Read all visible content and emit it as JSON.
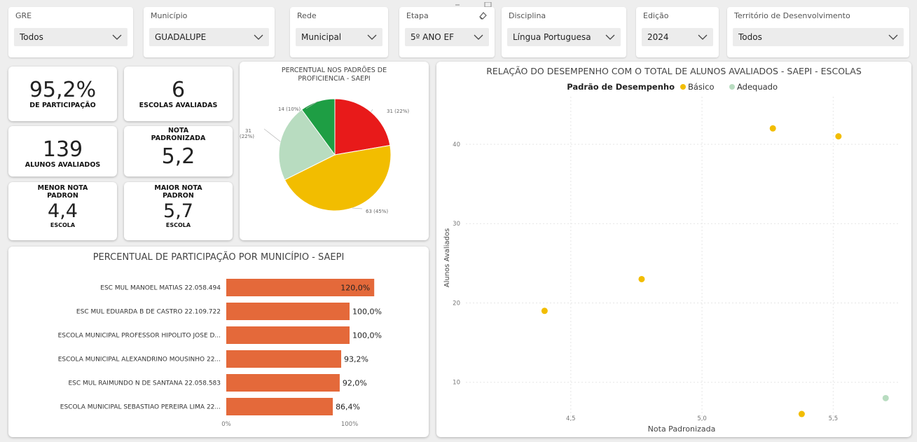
{
  "filters": [
    {
      "label": "GRE",
      "value": "Todos"
    },
    {
      "label": "Município",
      "value": "GUADALUPE"
    },
    {
      "label": "Rede",
      "value": "Municipal"
    },
    {
      "label": "Etapa",
      "value": "5º ANO EF"
    },
    {
      "label": "Disciplina",
      "value": "Língua Portuguesa"
    },
    {
      "label": "Edição",
      "value": "2024"
    },
    {
      "label": "Território de Desenvolvimento",
      "value": "Todos"
    }
  ],
  "kpis": {
    "participacao": {
      "value": "95,2%",
      "label": "DE PARTICIPAÇÃO"
    },
    "escolas": {
      "value": "6",
      "label": "ESCOLAS AVALIADAS"
    },
    "alunos": {
      "value": "139",
      "label": "ALUNOS AVALIADOS"
    },
    "nota": {
      "value": "5,2",
      "label1": "NOTA",
      "label2": "PADRONIZADA"
    },
    "menor": {
      "value": "4,4",
      "label1": "MENOR NOTA",
      "label2": "PADRON",
      "sub": "ESCOLA"
    },
    "maior": {
      "value": "5,7",
      "label1": "MAIOR NOTA",
      "label2": "PADRON",
      "sub": "ESCOLA"
    }
  },
  "colors": {
    "red": "#e81a1a",
    "yellow": "#f2bd00",
    "light_green": "#b8dcc0",
    "green": "#1e9e44",
    "bar": "#e4693a",
    "basico": "#f2bd00",
    "adequado": "#b8dcc0"
  },
  "chart_data": [
    {
      "type": "pie",
      "title": "PERCENTUAL NOS PADRÕES DE PROFICIENCIA - SAEPI",
      "slices": [
        {
          "label": "31 (22%)",
          "value": 31,
          "color": "#e81a1a"
        },
        {
          "label": "63 (45%)",
          "value": 63,
          "color": "#f2bd00"
        },
        {
          "label": "31 (22%)",
          "value": 31,
          "color": "#b8dcc0"
        },
        {
          "label": "14 (10%)",
          "value": 14,
          "color": "#1e9e44"
        }
      ]
    },
    {
      "type": "bar",
      "title": "PERCENTUAL DE PARTICIPAÇÃO POR MUNICÍPIO - SAEPI",
      "categories": [
        "ESC MUL MANOEL MATIAS 22.058.494",
        "ESC MUL EDUARDA B DE CASTRO 22.109.722",
        "ESCOLA MUNICIPAL PROFESSOR HIPOLITO JOSE D...",
        "ESCOLA MUNICIPAL ALEXANDRINO MOUSINHO 22...",
        "ESC MUL RAIMUNDO N DE SANTANA 22.058.583",
        "ESCOLA MUNICIPAL SEBASTIAO PEREIRA LIMA 22..."
      ],
      "values": [
        120.0,
        100.0,
        100.0,
        93.2,
        92.0,
        86.4
      ],
      "value_labels": [
        "120,0%",
        "100,0%",
        "100,0%",
        "93,2%",
        "92,0%",
        "86,4%"
      ],
      "xticks": [
        "0%",
        "100%"
      ],
      "xlim": [
        0,
        100
      ]
    },
    {
      "type": "scatter",
      "title": "RELAÇÃO DO DESEMPENHO COM O TOTAL DE ALUNOS AVALIADOS - SAEPI - ESCOLAS",
      "legend_title": "Padrão de Desempenho",
      "legend_position": "top",
      "xlabel": "Nota Padronizada",
      "ylabel": "Alunos Avaliados",
      "xticks": [
        "4,5",
        "5,0",
        "5,5"
      ],
      "yticks": [
        "10",
        "20",
        "30",
        "40"
      ],
      "xlim": [
        4.1,
        5.75
      ],
      "ylim": [
        4.5,
        46
      ],
      "series": [
        {
          "name": "Básico",
          "color": "#f2bd00",
          "points": [
            [
              4.4,
              19
            ],
            [
              4.77,
              23
            ],
            [
              5.27,
              42
            ],
            [
              5.52,
              41
            ],
            [
              5.38,
              6
            ]
          ]
        },
        {
          "name": "Adequado",
          "color": "#b8dcc0",
          "points": [
            [
              5.7,
              8
            ]
          ]
        }
      ]
    }
  ]
}
